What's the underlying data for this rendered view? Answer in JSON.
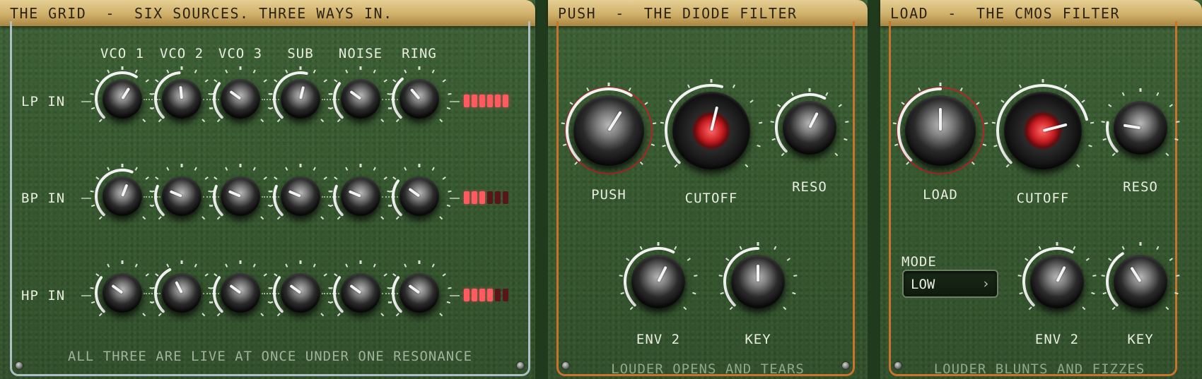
{
  "grid": {
    "title": "THE GRID  -  SIX SOURCES. THREE WAYS IN.",
    "columns": [
      "VCO 1",
      "VCO 2",
      "VCO 3",
      "SUB",
      "NOISE",
      "RING"
    ],
    "rows": [
      {
        "label": "LP IN",
        "levels": [
          0.62,
          0.48,
          0.3,
          0.55,
          0.3,
          0.35
        ],
        "meter_on": 6
      },
      {
        "label": "BP IN",
        "levels": [
          0.58,
          0.25,
          0.25,
          0.25,
          0.25,
          0.3
        ],
        "meter_on": 3
      },
      {
        "label": "HP IN",
        "levels": [
          0.3,
          0.4,
          0.3,
          0.3,
          0.3,
          0.3
        ],
        "meter_on": 4
      }
    ],
    "meter_segments": 6,
    "footer": "ALL THREE ARE LIVE AT ONCE UNDER ONE RESONANCE"
  },
  "push": {
    "title": "PUSH  -  THE DIODE FILTER",
    "knobs": {
      "push": {
        "label": "PUSH",
        "level": 0.62
      },
      "cutoff": {
        "label": "CUTOFF",
        "level": 0.55
      },
      "reso": {
        "label": "RESO",
        "level": 0.6
      },
      "env2": {
        "label": "ENV 2",
        "level": 0.6
      },
      "key": {
        "label": "KEY",
        "level": 0.5
      }
    },
    "footer": "LOUDER OPENS AND TEARS"
  },
  "load": {
    "title": "LOAD  -  THE CMOS FILTER",
    "knobs": {
      "load": {
        "label": "LOAD",
        "level": 0.5
      },
      "cutoff": {
        "label": "CUTOFF",
        "level": 0.78
      },
      "reso": {
        "label": "RESO",
        "level": 0.2
      },
      "env2": {
        "label": "ENV 2",
        "level": 0.6
      },
      "key": {
        "label": "KEY",
        "level": 0.38
      }
    },
    "mode_label": "MODE",
    "mode_value": "LOW",
    "footer": "LOUDER BLUNTS AND FIZZES"
  },
  "colors": {
    "panel": "#36582f",
    "header": "#d4b572",
    "accent_red": "#c81e22",
    "meter_on": "#ff5a60",
    "push_frame": "#c8742a",
    "grid_frame": "#b7c9cf"
  }
}
